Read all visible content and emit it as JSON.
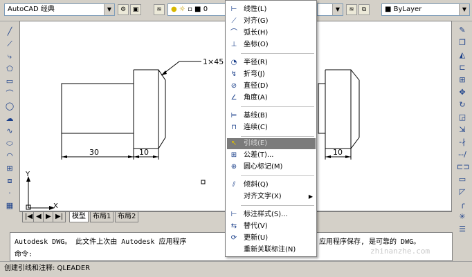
{
  "toolbar": {
    "workspace": "AutoCAD 经典",
    "layer_value": "0",
    "linetype": "ByLayer"
  },
  "drawing": {
    "leader_text": "1×45",
    "dim_30": "30",
    "dim_10_left": "10",
    "dim_10_right": "10",
    "axis_x": "X",
    "axis_y": "Y"
  },
  "tabs": [
    "模型",
    "布局1",
    "布局2"
  ],
  "command": {
    "line1_left": "Autodesk DWG。  此文件上次由 Autodesk 应用程序",
    "line1_right": "应用程序保存, 是可靠的 DWG。",
    "prompt": "命令:"
  },
  "status": "创建引线和注释:  QLEADER",
  "watermark": "zhinanzhe.com",
  "menu": {
    "items": [
      {
        "icon": "linear-dim-icon",
        "glyph": "⊢",
        "label": "线性(L)"
      },
      {
        "icon": "aligned-dim-icon",
        "glyph": "⟋",
        "label": "对齐(G)"
      },
      {
        "icon": "arc-length-icon",
        "glyph": "⌒",
        "label": "弧长(H)"
      },
      {
        "icon": "ordinate-icon",
        "glyph": "⊥",
        "label": "坐标(O)"
      },
      {
        "icon": "radius-icon",
        "glyph": "◔",
        "label": "半径(R)"
      },
      {
        "icon": "jogged-icon",
        "glyph": "↯",
        "label": "折弯(J)"
      },
      {
        "icon": "diameter-icon",
        "glyph": "⊘",
        "label": "直径(D)"
      },
      {
        "icon": "angular-icon",
        "glyph": "∠",
        "label": "角度(A)"
      },
      {
        "icon": "baseline-icon",
        "glyph": "⊨",
        "label": "基线(B)"
      },
      {
        "icon": "continue-icon",
        "glyph": "⊓",
        "label": "连续(C)"
      },
      {
        "icon": "leader-icon",
        "glyph": "↖",
        "label": "引线(E)"
      },
      {
        "icon": "tolerance-icon",
        "glyph": "⊞",
        "label": "公差(T)..."
      },
      {
        "icon": "center-mark-icon",
        "glyph": "⊕",
        "label": "圆心标记(M)"
      },
      {
        "icon": "oblique-icon",
        "glyph": "⫽",
        "label": "倾斜(Q)"
      },
      {
        "icon": "",
        "glyph": "",
        "label": "对齐文字(X)"
      },
      {
        "icon": "dim-style-icon",
        "glyph": "⊢",
        "label": "标注样式(S)..."
      },
      {
        "icon": "override-icon",
        "glyph": "⇆",
        "label": "替代(V)"
      },
      {
        "icon": "update-icon",
        "glyph": "⟳",
        "label": "更新(U)"
      },
      {
        "icon": "",
        "glyph": "",
        "label": "重新关联标注(N)"
      }
    ]
  },
  "colors": {
    "highlight": "#7b7b7b",
    "arrow": "#e8332b",
    "icon_blue": "#1a3f8a"
  }
}
